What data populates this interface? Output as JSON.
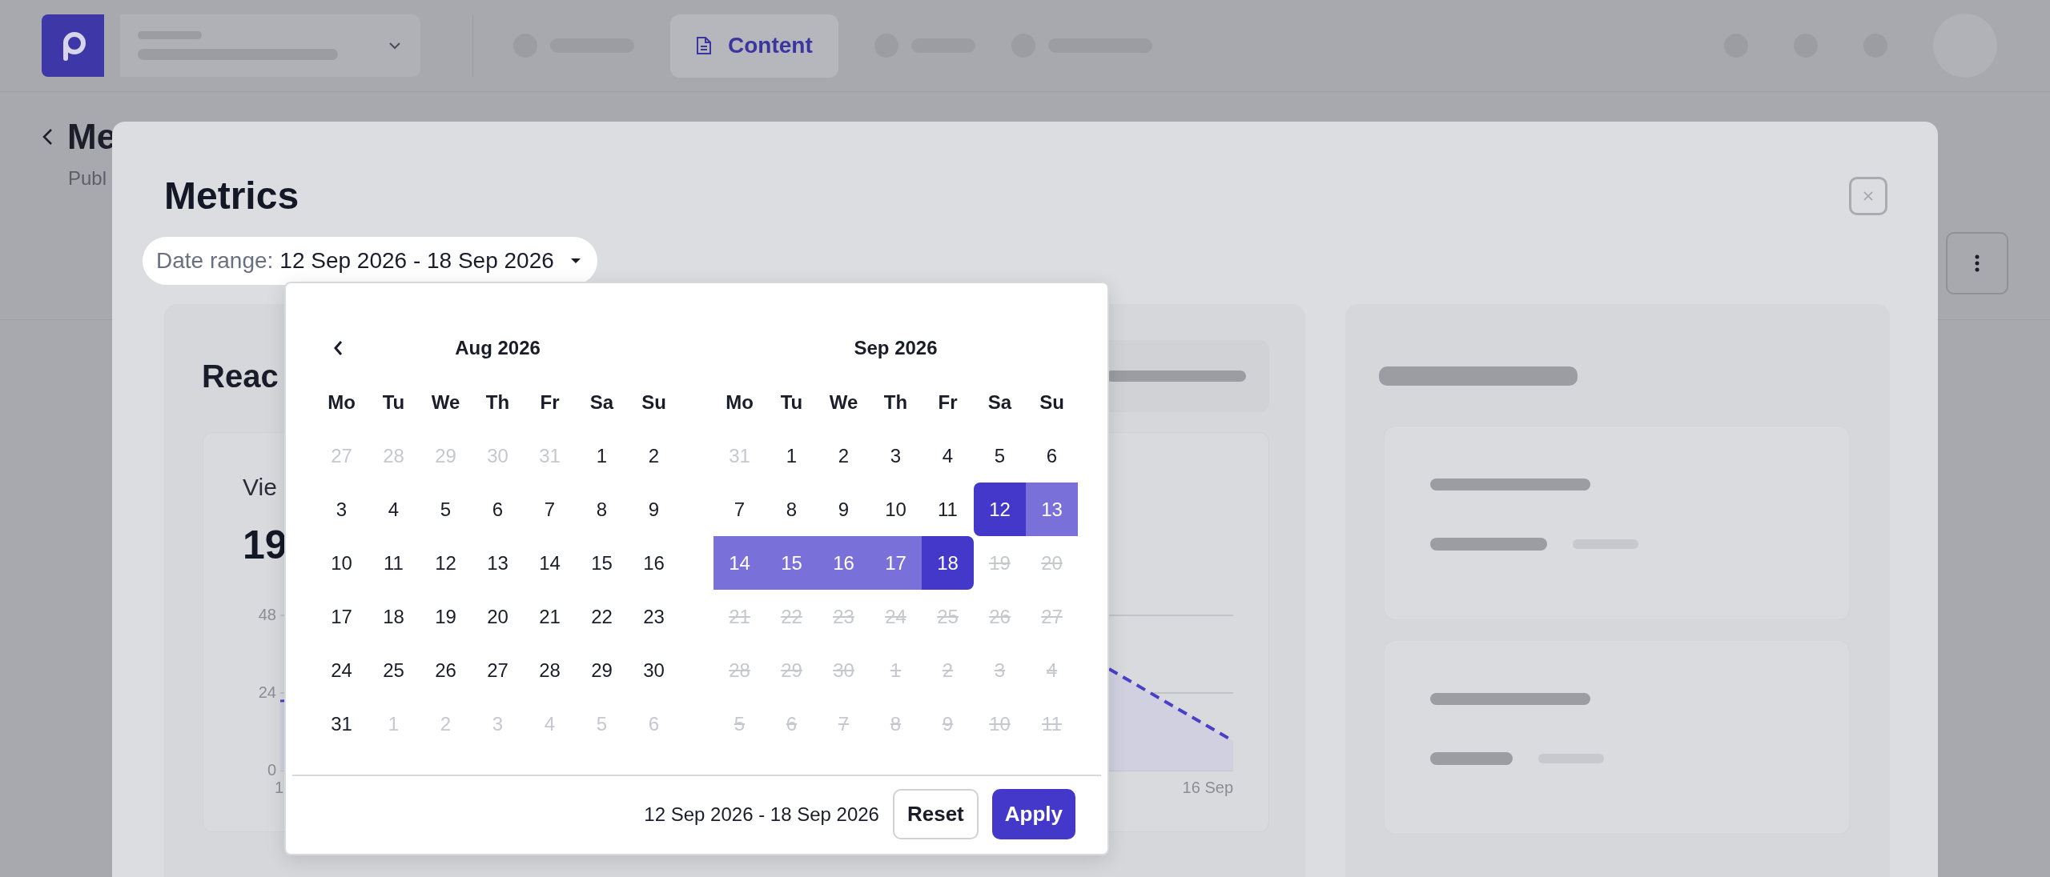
{
  "top_bar": {
    "active_tab": {
      "label": "Content"
    }
  },
  "page": {
    "title": "Me",
    "subtitle": "Publ"
  },
  "modal": {
    "title": "Metrics",
    "date_range": {
      "label": "Date range:",
      "value": "12 Sep 2026 - 18 Sep 2026"
    },
    "reach_card": {
      "title": "Reac",
      "views_label": "Vie",
      "views_value": "19",
      "y_ticks": [
        "48",
        "24",
        "0"
      ],
      "x_labels": [
        "1",
        "16 Sep"
      ]
    }
  },
  "date_picker": {
    "months": [
      {
        "title": "Aug 2026",
        "has_prev_button": true,
        "weekdays": [
          "Mo",
          "Tu",
          "We",
          "Th",
          "Fr",
          "Sa",
          "Su"
        ],
        "weeks": [
          [
            {
              "day": "27",
              "kind": "outside"
            },
            {
              "day": "28",
              "kind": "outside"
            },
            {
              "day": "29",
              "kind": "outside"
            },
            {
              "day": "30",
              "kind": "outside"
            },
            {
              "day": "31",
              "kind": "outside"
            },
            {
              "day": "1",
              "kind": "normal"
            },
            {
              "day": "2",
              "kind": "normal"
            }
          ],
          [
            {
              "day": "3",
              "kind": "normal"
            },
            {
              "day": "4",
              "kind": "normal"
            },
            {
              "day": "5",
              "kind": "normal"
            },
            {
              "day": "6",
              "kind": "normal"
            },
            {
              "day": "7",
              "kind": "normal"
            },
            {
              "day": "8",
              "kind": "normal"
            },
            {
              "day": "9",
              "kind": "normal"
            }
          ],
          [
            {
              "day": "10",
              "kind": "normal"
            },
            {
              "day": "11",
              "kind": "normal"
            },
            {
              "day": "12",
              "kind": "normal"
            },
            {
              "day": "13",
              "kind": "normal"
            },
            {
              "day": "14",
              "kind": "normal"
            },
            {
              "day": "15",
              "kind": "normal"
            },
            {
              "day": "16",
              "kind": "normal"
            }
          ],
          [
            {
              "day": "17",
              "kind": "normal"
            },
            {
              "day": "18",
              "kind": "normal"
            },
            {
              "day": "19",
              "kind": "normal"
            },
            {
              "day": "20",
              "kind": "normal"
            },
            {
              "day": "21",
              "kind": "normal"
            },
            {
              "day": "22",
              "kind": "normal"
            },
            {
              "day": "23",
              "kind": "normal"
            }
          ],
          [
            {
              "day": "24",
              "kind": "normal"
            },
            {
              "day": "25",
              "kind": "normal"
            },
            {
              "day": "26",
              "kind": "normal"
            },
            {
              "day": "27",
              "kind": "normal"
            },
            {
              "day": "28",
              "kind": "normal"
            },
            {
              "day": "29",
              "kind": "normal"
            },
            {
              "day": "30",
              "kind": "normal"
            }
          ],
          [
            {
              "day": "31",
              "kind": "normal"
            },
            {
              "day": "1",
              "kind": "outside"
            },
            {
              "day": "2",
              "kind": "outside"
            },
            {
              "day": "3",
              "kind": "outside"
            },
            {
              "day": "4",
              "kind": "outside"
            },
            {
              "day": "5",
              "kind": "outside"
            },
            {
              "day": "6",
              "kind": "outside"
            }
          ]
        ]
      },
      {
        "title": "Sep 2026",
        "weekdays": [
          "Mo",
          "Tu",
          "We",
          "Th",
          "Fr",
          "Sa",
          "Su"
        ],
        "weeks": [
          [
            {
              "day": "31",
              "kind": "outside"
            },
            {
              "day": "1",
              "kind": "normal"
            },
            {
              "day": "2",
              "kind": "normal"
            },
            {
              "day": "3",
              "kind": "normal"
            },
            {
              "day": "4",
              "kind": "normal"
            },
            {
              "day": "5",
              "kind": "normal"
            },
            {
              "day": "6",
              "kind": "normal"
            }
          ],
          [
            {
              "day": "7",
              "kind": "normal"
            },
            {
              "day": "8",
              "kind": "normal"
            },
            {
              "day": "9",
              "kind": "normal"
            },
            {
              "day": "10",
              "kind": "normal"
            },
            {
              "day": "11",
              "kind": "normal"
            },
            {
              "day": "12",
              "kind": "range-start"
            },
            {
              "day": "13",
              "kind": "in-range"
            }
          ],
          [
            {
              "day": "14",
              "kind": "in-range"
            },
            {
              "day": "15",
              "kind": "in-range"
            },
            {
              "day": "16",
              "kind": "in-range"
            },
            {
              "day": "17",
              "kind": "in-range"
            },
            {
              "day": "18",
              "kind": "range-end"
            },
            {
              "day": "19",
              "kind": "disabled"
            },
            {
              "day": "20",
              "kind": "disabled"
            }
          ],
          [
            {
              "day": "21",
              "kind": "disabled"
            },
            {
              "day": "22",
              "kind": "disabled"
            },
            {
              "day": "23",
              "kind": "disabled"
            },
            {
              "day": "24",
              "kind": "disabled"
            },
            {
              "day": "25",
              "kind": "disabled"
            },
            {
              "day": "26",
              "kind": "disabled"
            },
            {
              "day": "27",
              "kind": "disabled"
            }
          ],
          [
            {
              "day": "28",
              "kind": "disabled"
            },
            {
              "day": "29",
              "kind": "disabled"
            },
            {
              "day": "30",
              "kind": "disabled"
            },
            {
              "day": "1",
              "kind": "disabled"
            },
            {
              "day": "2",
              "kind": "disabled"
            },
            {
              "day": "3",
              "kind": "disabled"
            },
            {
              "day": "4",
              "kind": "disabled"
            }
          ],
          [
            {
              "day": "5",
              "kind": "disabled"
            },
            {
              "day": "6",
              "kind": "disabled"
            },
            {
              "day": "7",
              "kind": "disabled"
            },
            {
              "day": "8",
              "kind": "disabled"
            },
            {
              "day": "9",
              "kind": "disabled"
            },
            {
              "day": "10",
              "kind": "disabled"
            },
            {
              "day": "11",
              "kind": "disabled"
            }
          ]
        ]
      }
    ],
    "summary": "12 Sep 2026 - 18 Sep 2026",
    "buttons": [
      {
        "label": "Reset",
        "kind": "secondary"
      },
      {
        "label": "Apply",
        "kind": "primary"
      }
    ]
  }
}
